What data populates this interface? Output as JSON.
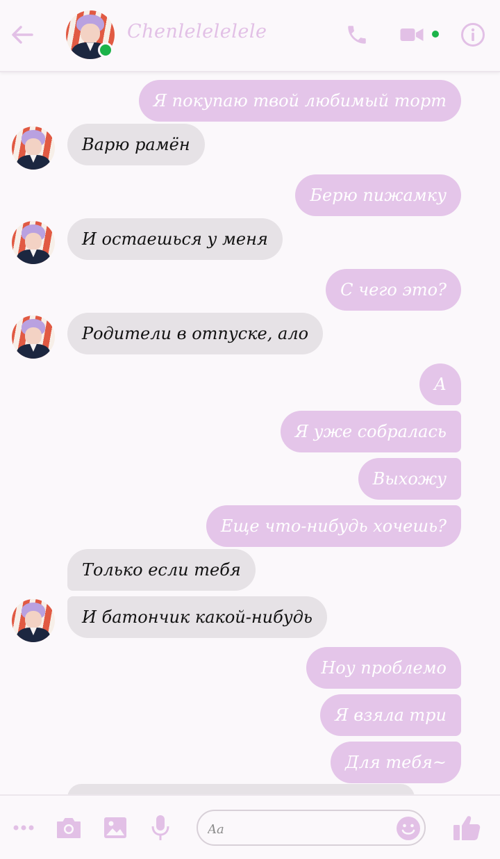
{
  "header": {
    "contact_name": "Chenlelelelele",
    "online": true
  },
  "messages": [
    {
      "dir": "sent",
      "text": "Я покупаю твой любимый торт"
    },
    {
      "dir": "recv",
      "text": "Варю рамён"
    },
    {
      "dir": "sent",
      "text": "Берю пижамку"
    },
    {
      "dir": "recv",
      "text": "И остаешься у меня"
    },
    {
      "dir": "sent",
      "text": "С чего это?"
    },
    {
      "dir": "recv",
      "text": "Родители в отпуске, ало"
    },
    {
      "dir": "sent",
      "text": "А"
    },
    {
      "dir": "sent",
      "text": "Я уже собралась"
    },
    {
      "dir": "sent",
      "text": "Выхожу"
    },
    {
      "dir": "sent",
      "text": "Еще что-нибудь хочешь?"
    },
    {
      "dir": "recv",
      "text": "Только если тебя"
    },
    {
      "dir": "recv",
      "text": "И батончик какой-нибудь"
    },
    {
      "dir": "sent",
      "text": "Ноу проблемо"
    },
    {
      "dir": "sent",
      "text": "Я взяла три"
    },
    {
      "dir": "sent",
      "text": "Для тебя~"
    }
  ],
  "composer": {
    "placeholder": "Aa"
  },
  "colors": {
    "accent": "#e2c0e6",
    "sent_bubble": "#e4c5e9",
    "recv_bubble": "#e6e2e6",
    "online": "#1cb34a"
  },
  "icons": [
    "back-arrow-icon",
    "phone-icon",
    "video-icon",
    "info-icon",
    "more-icon",
    "camera-icon",
    "image-icon",
    "mic-icon",
    "emoji-icon",
    "like-icon"
  ]
}
